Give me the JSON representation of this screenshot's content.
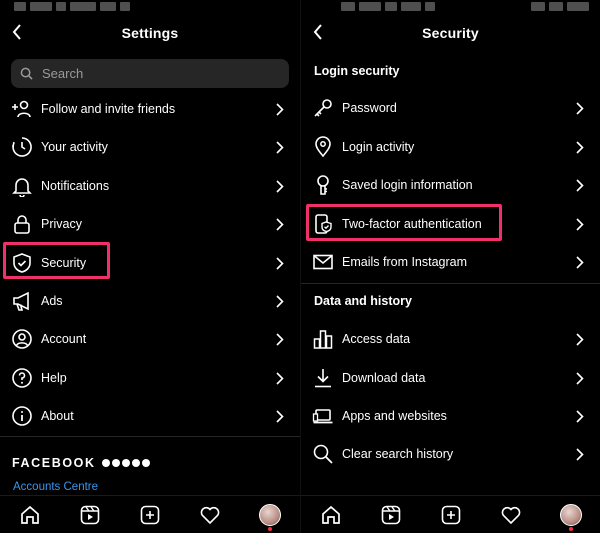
{
  "left": {
    "title": "Settings",
    "search": {
      "placeholder": "Search"
    },
    "items": [
      {
        "label": "Follow and invite friends",
        "icon": "add-person-icon"
      },
      {
        "label": "Your activity",
        "icon": "activity-clock-icon"
      },
      {
        "label": "Notifications",
        "icon": "bell-icon"
      },
      {
        "label": "Privacy",
        "icon": "lock-icon"
      },
      {
        "label": "Security",
        "icon": "shield-icon"
      },
      {
        "label": "Ads",
        "icon": "megaphone-icon"
      },
      {
        "label": "Account",
        "icon": "user-circle-icon"
      },
      {
        "label": "Help",
        "icon": "help-icon"
      },
      {
        "label": "About",
        "icon": "info-icon"
      }
    ],
    "brand": "FACEBOOK",
    "accounts_centre": "Accounts Centre"
  },
  "right": {
    "title": "Security",
    "sections": {
      "login_security": "Login security",
      "data_history": "Data and history"
    },
    "login_items": [
      {
        "label": "Password",
        "icon": "key-icon"
      },
      {
        "label": "Login activity",
        "icon": "location-pin-icon"
      },
      {
        "label": "Saved login information",
        "icon": "keyhole-icon"
      },
      {
        "label": "Two-factor authentication",
        "icon": "phone-shield-icon"
      },
      {
        "label": "Emails from Instagram",
        "icon": "mail-icon"
      }
    ],
    "data_items": [
      {
        "label": "Access data",
        "icon": "bar-chart-icon"
      },
      {
        "label": "Download data",
        "icon": "download-icon"
      },
      {
        "label": "Apps and websites",
        "icon": "laptop-icon"
      },
      {
        "label": "Clear search history",
        "icon": "search-icon"
      }
    ]
  },
  "highlight_color": "#f0306a",
  "link_color": "#3797f0"
}
